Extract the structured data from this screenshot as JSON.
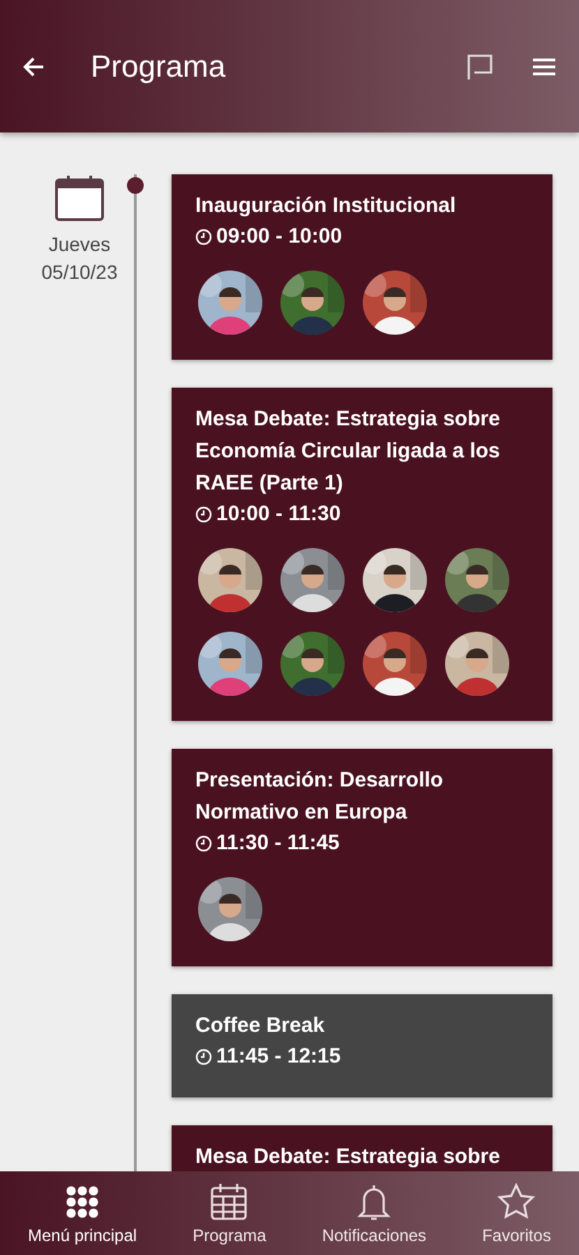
{
  "header": {
    "title": "Programa"
  },
  "day": {
    "weekday": "Jueves",
    "date": "05/10/23"
  },
  "sessions": [
    {
      "kind": "session",
      "title": "Inauguración Institucional",
      "time": "09:00 - 10:00"
    },
    {
      "kind": "session",
      "title": "Mesa Debate: Estrategia sobre Economía Circular ligada a los RAEE (Parte 1)",
      "time": "10:00 - 11:30"
    },
    {
      "kind": "session",
      "title": "Presentación: Desarrollo Normativo en Europa",
      "time": "11:30 - 11:45"
    },
    {
      "kind": "break",
      "title": "Coffee Break",
      "time": "11:45 - 12:15"
    },
    {
      "kind": "session",
      "title": "Mesa Debate: Estrategia sobre"
    }
  ],
  "nav": [
    {
      "kind": "grid",
      "label": "Menú principal",
      "selected": true
    },
    {
      "kind": "calendar",
      "label": "Programa",
      "selected": false
    },
    {
      "kind": "bell",
      "label": "Notificaciones",
      "selected": false
    },
    {
      "kind": "star",
      "label": "Favoritos",
      "selected": false
    }
  ]
}
